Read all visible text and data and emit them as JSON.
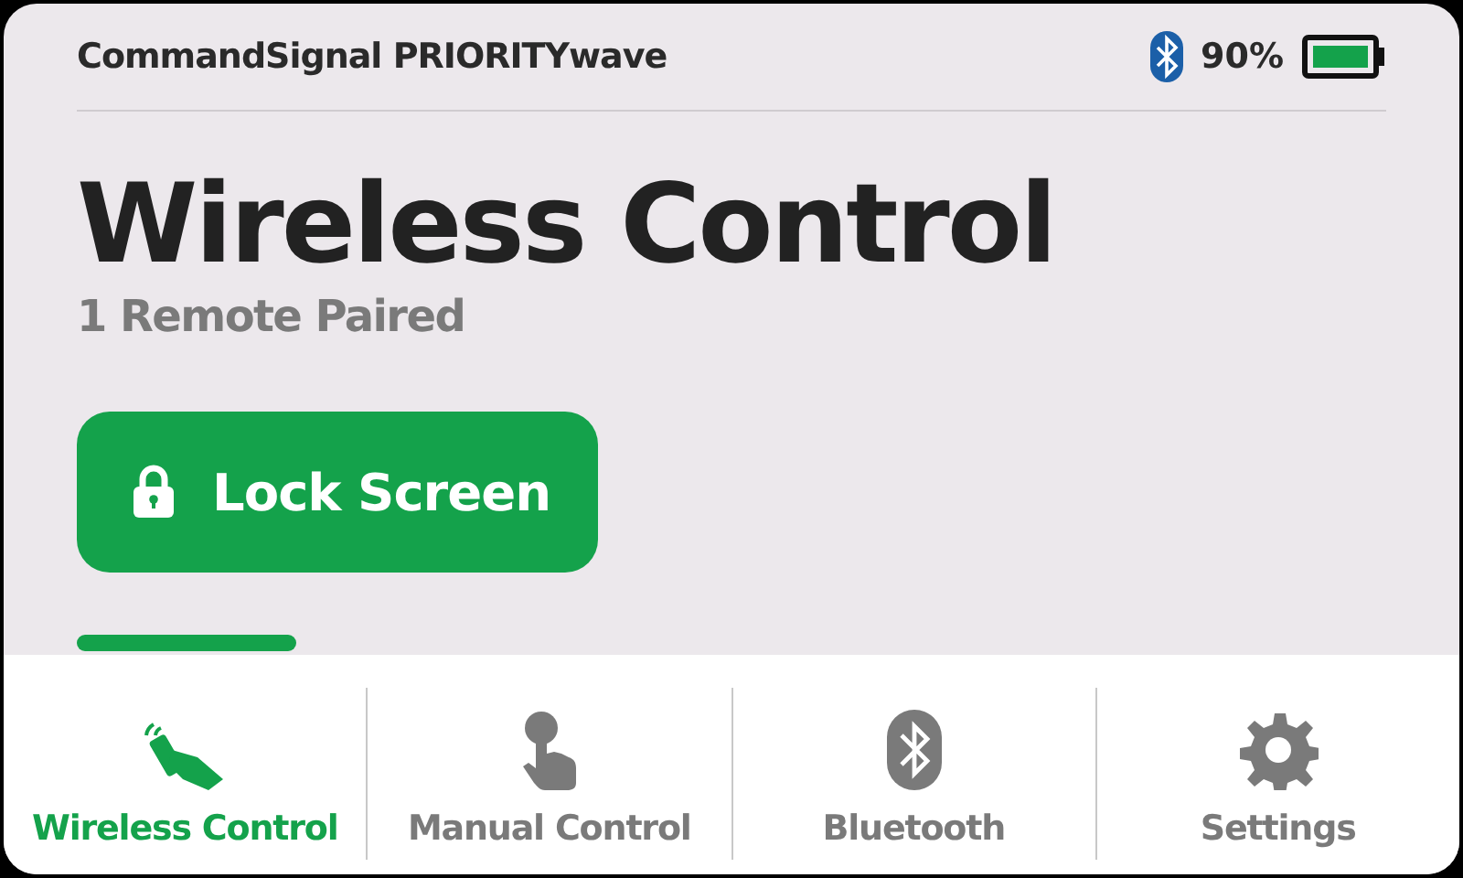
{
  "header": {
    "title": "CommandSignal PRIORITYwave",
    "battery_reading": "90%"
  },
  "page": {
    "title": "Wireless Control",
    "subtitle": "1 Remote Paired"
  },
  "lock_button": {
    "label": "Lock Screen"
  },
  "tabs": [
    {
      "label": "Wireless Control",
      "kind": "remote",
      "selected": true
    },
    {
      "label": "Manual Control",
      "kind": "touch",
      "selected": false
    },
    {
      "label": "Bluetooth",
      "kind": "bluetooth",
      "selected": false
    },
    {
      "label": "Settings",
      "kind": "gear",
      "selected": false
    }
  ]
}
